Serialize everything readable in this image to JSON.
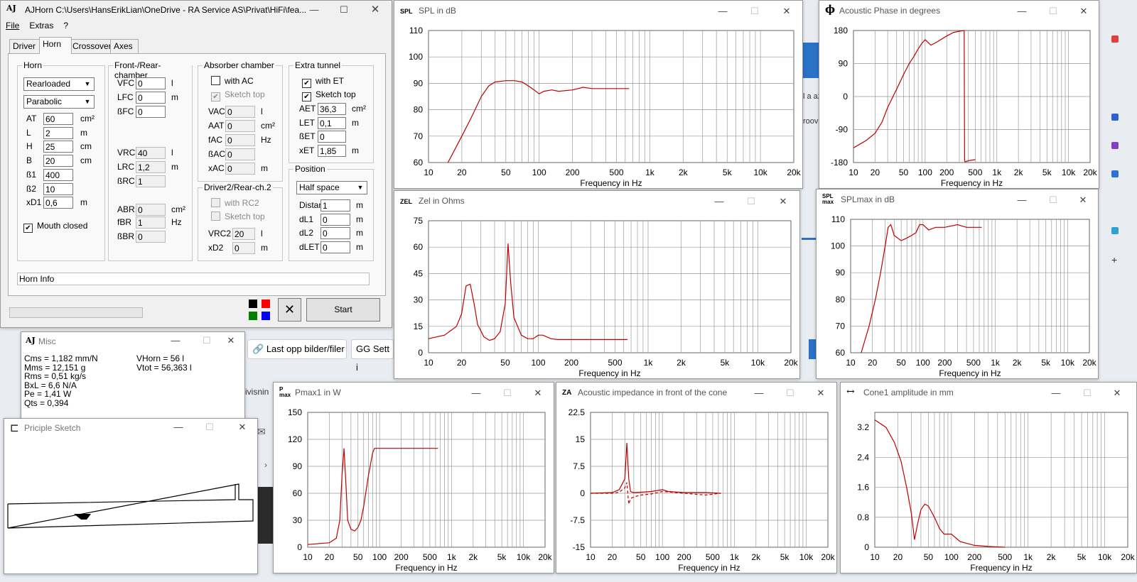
{
  "background": {
    "left_btn": "Last opp bilder/filer",
    "right_btn": "Sett i",
    "frag1": "ivisnin",
    "frag2": "l a a2",
    "frag3": "roov"
  },
  "main": {
    "logo": "AJ",
    "title": "AJHorn  C:\\Users\\HansErikLian\\OneDrive - RA Service AS\\Privat\\HiFi\\fea...",
    "menu": [
      "File",
      "Extras",
      "?"
    ],
    "tabs": [
      "Driver",
      "Horn",
      "Crossover",
      "Axes"
    ],
    "horn": {
      "group": "Horn",
      "type": "Rearloaded",
      "profile": "Parabolic",
      "rows": [
        {
          "label": "AT",
          "value": "60",
          "unit": "cm²"
        },
        {
          "label": "L",
          "value": "2",
          "unit": "m"
        },
        {
          "label": "H",
          "value": "25",
          "unit": "cm"
        },
        {
          "label": "B",
          "value": "20",
          "unit": "cm"
        },
        {
          "label": "ß1",
          "value": "400",
          "unit": ""
        },
        {
          "label": "ß2",
          "value": "10",
          "unit": ""
        },
        {
          "label": "xD1",
          "value": "0,6",
          "unit": "m"
        }
      ],
      "mouth_closed": "Mouth closed"
    },
    "front": {
      "group": "Front-/Rear-chamber",
      "rows": [
        {
          "label": "VFC",
          "value": "0",
          "unit": "l"
        },
        {
          "label": "LFC",
          "value": "0",
          "unit": "m"
        },
        {
          "label": "ßFC",
          "value": "0",
          "unit": ""
        },
        {
          "label": "VRC",
          "value": "40",
          "unit": "l"
        },
        {
          "label": "LRC",
          "value": "1,2",
          "unit": "m"
        },
        {
          "label": "ßRC",
          "value": "1",
          "unit": ""
        },
        {
          "label": "ABR",
          "value": "0",
          "unit": "cm²"
        },
        {
          "label": "fBR",
          "value": "1",
          "unit": "Hz"
        },
        {
          "label": "ßBR",
          "value": "0",
          "unit": ""
        }
      ]
    },
    "absorber": {
      "group": "Absorber chamber",
      "with_ac": "with AC",
      "sketch_top": "Sketch top",
      "rows": [
        {
          "label": "VAC",
          "value": "0",
          "unit": "l"
        },
        {
          "label": "AAT",
          "value": "0",
          "unit": "cm²"
        },
        {
          "label": "fAC",
          "value": "0",
          "unit": "Hz"
        },
        {
          "label": "ßAC",
          "value": "0",
          "unit": ""
        },
        {
          "label": "xAC",
          "value": "0",
          "unit": "m"
        }
      ]
    },
    "driver2": {
      "group": "Driver2/Rear-ch.2",
      "with_rc2": "with RC2",
      "sketch_top": "Sketch top",
      "rows": [
        {
          "label": "VRC2",
          "value": "20",
          "unit": "l"
        },
        {
          "label": "xD2",
          "value": "0",
          "unit": "m"
        }
      ]
    },
    "tunnel": {
      "group": "Extra tunnel",
      "with_et": "with ET",
      "sketch_top": "Sketch top",
      "rows": [
        {
          "label": "AET",
          "value": "36,3",
          "unit": "cm²"
        },
        {
          "label": "LET",
          "value": "0,1",
          "unit": "m"
        },
        {
          "label": "ßET",
          "value": "0",
          "unit": ""
        },
        {
          "label": "xET",
          "value": "1,85",
          "unit": "m"
        }
      ]
    },
    "position": {
      "group": "Position",
      "mode": "Half space",
      "rows": [
        {
          "label": "Distance",
          "value": "1",
          "unit": "m"
        },
        {
          "label": "dL1",
          "value": "0",
          "unit": "m"
        },
        {
          "label": "dL2",
          "value": "0",
          "unit": "m"
        },
        {
          "label": "dLET",
          "value": "0",
          "unit": "m"
        }
      ]
    },
    "info": "Horn Info",
    "start": "Start",
    "close_x": "✕",
    "colors": [
      "#000000",
      "#ff0000",
      "#008000",
      "#0000ff"
    ]
  },
  "misc": {
    "logo": "AJ",
    "title": "Misc",
    "left": [
      "Cms = 1,182 mm/N",
      "Mms = 12,151 g",
      "Rms = 0,51 kg/s",
      "BxL = 6,6 N/A",
      "Pe = 1,41 W",
      "Qts = 0,394"
    ],
    "right": [
      "VHorn = 56 l",
      "Vtot = 56,363 l"
    ]
  },
  "sketch": {
    "title": "Priciple Sketch"
  },
  "charts": [
    {
      "id": "spl",
      "icon": "SPL",
      "title": "SPL in dB"
    },
    {
      "id": "phase",
      "icon": "ϕ",
      "title": "Acoustic Phase in degrees"
    },
    {
      "id": "zel",
      "icon": "ZEL",
      "title": "Zel in Ohms"
    },
    {
      "id": "splmax",
      "icon": "SPL max",
      "title": "SPLmax in dB"
    },
    {
      "id": "pmax",
      "icon": "P max",
      "title": "Pmax1 in W"
    },
    {
      "id": "za",
      "icon": "ZA",
      "title": "Acoustic impedance in front of the cone"
    },
    {
      "id": "cone",
      "icon": "↔",
      "title": "Cone1 amplitude in mm"
    }
  ],
  "chart_data": [
    {
      "id": "spl",
      "type": "line",
      "title": "SPL in dB",
      "xlabel": "Frequency in Hz",
      "xscale": "log",
      "xlim": [
        10,
        20000
      ],
      "ylim": [
        60,
        110
      ],
      "xticks": [
        10,
        20,
        50,
        100,
        200,
        500,
        1000,
        2000,
        5000,
        10000,
        20000
      ],
      "xticklabels": [
        "10",
        "20",
        "50",
        "100",
        "200",
        "500",
        "1k",
        "2k",
        "5k",
        "10k",
        "20k"
      ],
      "yticks": [
        60,
        70,
        80,
        90,
        100,
        110
      ],
      "yticklabels": [
        "60",
        "70",
        "80",
        "90",
        "100",
        "110"
      ],
      "series": [
        {
          "color": "#c00000",
          "x": [
            15,
            20,
            25,
            30,
            35,
            40,
            50,
            60,
            70,
            80,
            90,
            100,
            110,
            130,
            150,
            200,
            250,
            300,
            400,
            500,
            650
          ],
          "y": [
            60,
            70,
            78,
            85,
            89,
            90.5,
            91,
            91,
            90.5,
            89,
            87.5,
            86,
            87,
            87.5,
            87,
            87.5,
            88.5,
            88,
            88,
            88,
            88
          ]
        }
      ]
    },
    {
      "id": "phase",
      "type": "line",
      "title": "Acoustic Phase in degrees",
      "xlabel": "Frequency in Hz",
      "xscale": "log",
      "xlim": [
        10,
        20000
      ],
      "ylim": [
        -180,
        180
      ],
      "xticks": [
        10,
        20,
        50,
        100,
        200,
        500,
        1000,
        2000,
        5000,
        10000,
        20000
      ],
      "xticklabels": [
        "10",
        "20",
        "50",
        "100",
        "200",
        "500",
        "1k",
        "2k",
        "5k",
        "10k",
        "20k"
      ],
      "yticks": [
        -180,
        -90,
        0,
        90,
        180
      ],
      "yticklabels": [
        "-180",
        "-90",
        "0",
        "90",
        "180"
      ],
      "series": [
        {
          "color": "#c00000",
          "x": [
            10,
            15,
            20,
            25,
            30,
            40,
            50,
            60,
            70,
            80,
            90,
            100,
            120,
            150,
            200,
            250,
            300,
            350,
            355,
            360,
            400,
            500
          ],
          "y": [
            -140,
            -120,
            -100,
            -70,
            -30,
            20,
            60,
            90,
            110,
            130,
            145,
            155,
            140,
            150,
            165,
            175,
            178,
            180,
            -175,
            -178,
            -175,
            -172
          ]
        }
      ]
    },
    {
      "id": "zel",
      "type": "line",
      "title": "Zel in Ohms",
      "xlabel": "Frequency in Hz",
      "xscale": "log",
      "xlim": [
        10,
        20000
      ],
      "ylim": [
        0,
        75
      ],
      "xticks": [
        10,
        20,
        50,
        100,
        200,
        500,
        1000,
        2000,
        5000,
        10000,
        20000
      ],
      "xticklabels": [
        "10",
        "20",
        "50",
        "100",
        "200",
        "500",
        "1k",
        "2k",
        "5k",
        "10k",
        "20k"
      ],
      "yticks": [
        0,
        15,
        30,
        45,
        60,
        75
      ],
      "yticklabels": [
        "0",
        "15",
        "30",
        "45",
        "60",
        "75"
      ],
      "series": [
        {
          "color": "#c00000",
          "x": [
            10,
            14,
            18,
            20,
            22,
            24,
            26,
            28,
            32,
            36,
            40,
            45,
            50,
            53,
            56,
            60,
            70,
            80,
            90,
            100,
            110,
            130,
            150,
            200,
            300,
            650
          ],
          "y": [
            8,
            10,
            15,
            22,
            38,
            39,
            28,
            16,
            9,
            7,
            8,
            12,
            28,
            62,
            40,
            20,
            10,
            8,
            8,
            10,
            10,
            8,
            7.5,
            7.5,
            7.5,
            7.5
          ]
        }
      ]
    },
    {
      "id": "splmax",
      "type": "line",
      "title": "SPLmax in dB",
      "xlabel": "Frequency in Hz",
      "xscale": "log",
      "xlim": [
        10,
        20000
      ],
      "ylim": [
        60,
        110
      ],
      "xticks": [
        10,
        20,
        50,
        100,
        200,
        500,
        1000,
        2000,
        5000,
        10000,
        20000
      ],
      "xticklabels": [
        "10",
        "20",
        "50",
        "100",
        "200",
        "500",
        "1k",
        "2k",
        "5k",
        "10k",
        "20k"
      ],
      "yticks": [
        60,
        70,
        80,
        90,
        100,
        110
      ],
      "yticklabels": [
        "60",
        "70",
        "80",
        "90",
        "100",
        "110"
      ],
      "series": [
        {
          "color": "#c00000",
          "x": [
            14,
            18,
            22,
            26,
            30,
            33,
            36,
            40,
            50,
            60,
            70,
            80,
            90,
            100,
            120,
            150,
            200,
            300,
            400,
            500,
            650
          ],
          "y": [
            60,
            70,
            80,
            90,
            100,
            107,
            108,
            104,
            102,
            103,
            104,
            105,
            108,
            108,
            106,
            107,
            107,
            108,
            107,
            107,
            107
          ]
        }
      ]
    },
    {
      "id": "pmax",
      "type": "line",
      "title": "Pmax1 in W",
      "xlabel": "Frequency in Hz",
      "xscale": "log",
      "xlim": [
        10,
        20000
      ],
      "ylim": [
        0,
        150
      ],
      "xticks": [
        10,
        20,
        50,
        100,
        200,
        500,
        1000,
        2000,
        5000,
        10000,
        20000
      ],
      "xticklabels": [
        "10",
        "20",
        "50",
        "100",
        "200",
        "500",
        "1k",
        "2k",
        "5k",
        "10k",
        "20k"
      ],
      "yticks": [
        0,
        30,
        60,
        90,
        120,
        150
      ],
      "yticklabels": [
        "0",
        "30",
        "60",
        "90",
        "120",
        "150"
      ],
      "series": [
        {
          "color": "#c00000",
          "x": [
            10,
            20,
            25,
            28,
            30,
            32,
            34,
            36,
            40,
            45,
            50,
            55,
            60,
            70,
            80,
            85,
            90,
            100,
            150,
            300,
            650
          ],
          "y": [
            3,
            5,
            10,
            30,
            80,
            110,
            70,
            30,
            20,
            18,
            22,
            30,
            45,
            80,
            105,
            110,
            110,
            110,
            110,
            110,
            110
          ]
        }
      ]
    },
    {
      "id": "za",
      "type": "line",
      "title": "Acoustic impedance in front of the cone",
      "xlabel": "Frequency in Hz",
      "xscale": "log",
      "xlim": [
        10,
        20000
      ],
      "ylim": [
        -15,
        22.5
      ],
      "xticks": [
        10,
        20,
        50,
        100,
        200,
        500,
        1000,
        2000,
        5000,
        10000,
        20000
      ],
      "xticklabels": [
        "10",
        "20",
        "50",
        "100",
        "200",
        "500",
        "1k",
        "2k",
        "5k",
        "10k",
        "20k"
      ],
      "yticks": [
        -15,
        -7.5,
        0,
        7.5,
        15,
        22.5
      ],
      "yticklabels": [
        "-15",
        "-7.5",
        "0",
        "7.5",
        "15",
        "22.5"
      ],
      "series": [
        {
          "color": "#c00000",
          "x": [
            10,
            20,
            25,
            30,
            32,
            34,
            36,
            38,
            40,
            50,
            70,
            100,
            120,
            200,
            400,
            650
          ],
          "y": [
            0,
            0.2,
            1,
            4,
            14,
            4,
            0.5,
            0.3,
            0.2,
            0.3,
            0.5,
            1,
            0.5,
            0.2,
            0.2,
            0
          ]
        },
        {
          "color": "#c00000",
          "dashed": true,
          "x": [
            10,
            20,
            25,
            30,
            32,
            34,
            36,
            40,
            50,
            70,
            100,
            200,
            400,
            650
          ],
          "y": [
            0,
            0,
            0.3,
            1.5,
            3,
            -3,
            -1.5,
            -1,
            -0.5,
            -0.2,
            0.5,
            0,
            -0.5,
            0
          ]
        }
      ]
    },
    {
      "id": "cone",
      "type": "line",
      "title": "Cone1 amplitude in mm",
      "xlabel": "Frequency in Hz",
      "xscale": "log",
      "xlim": [
        10,
        20000
      ],
      "ylim": [
        0,
        3.6
      ],
      "xticks": [
        10,
        20,
        50,
        100,
        200,
        500,
        1000,
        2000,
        5000,
        10000,
        20000
      ],
      "xticklabels": [
        "10",
        "20",
        "50",
        "100",
        "200",
        "500",
        "1k",
        "2k",
        "5k",
        "10k",
        "20k"
      ],
      "yticks": [
        0,
        0.8,
        1.6,
        2.4,
        3.2
      ],
      "yticklabels": [
        "0",
        "0.8",
        "1.6",
        "2.4",
        "3.2"
      ],
      "series": [
        {
          "color": "#c00000",
          "x": [
            10,
            14,
            18,
            22,
            26,
            30,
            33,
            36,
            40,
            45,
            50,
            60,
            70,
            80,
            100,
            130,
            200,
            300,
            500
          ],
          "y": [
            3.4,
            3.2,
            2.8,
            2.3,
            1.6,
            0.9,
            0.2,
            0.6,
            1.0,
            1.15,
            1.1,
            0.8,
            0.5,
            0.35,
            0.35,
            0.15,
            0.05,
            0.02,
            0
          ]
        }
      ]
    }
  ]
}
